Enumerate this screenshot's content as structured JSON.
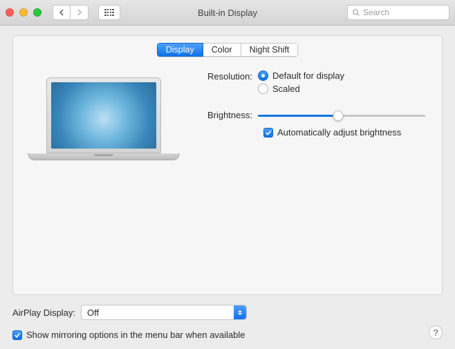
{
  "window": {
    "title": "Built-in Display"
  },
  "search": {
    "placeholder": "Search"
  },
  "tabs": {
    "display": "Display",
    "color": "Color",
    "night_shift": "Night Shift",
    "active": "display"
  },
  "resolution": {
    "label": "Resolution:",
    "default_label": "Default for display",
    "scaled_label": "Scaled",
    "selected": "default"
  },
  "brightness": {
    "label": "Brightness:",
    "value_percent": 48,
    "auto_label": "Automatically adjust brightness",
    "auto_checked": true
  },
  "airplay": {
    "label": "AirPlay Display:",
    "value": "Off"
  },
  "mirroring": {
    "label": "Show mirroring options in the menu bar when available",
    "checked": true
  },
  "help": {
    "symbol": "?"
  }
}
